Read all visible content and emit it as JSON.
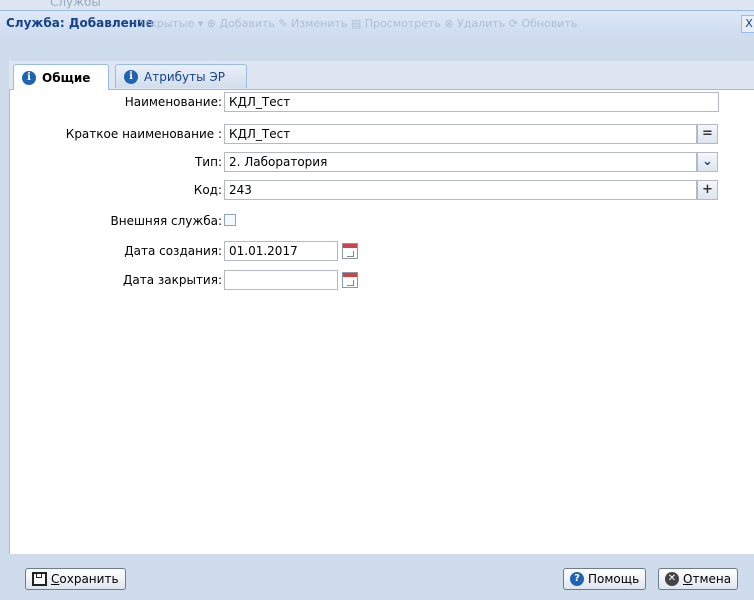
{
  "background": {
    "ghost_title": "Службы"
  },
  "dialog": {
    "title": "Служба: Добавление",
    "ghost_toolbar": "Открытые ▾   ⊕ Добавить   ✎ Изменить   ▤ Просмотреть   ⊗ Удалить   ⟳ Обновить",
    "close_glyph": "X"
  },
  "tabs": [
    {
      "label": "Общие",
      "active": true
    },
    {
      "label": "Атрибуты ЭР",
      "active": false
    }
  ],
  "form": {
    "name": {
      "label": "Наименование:",
      "value": "КДЛ_Тест"
    },
    "short_name": {
      "label": "Краткое наименование :",
      "value": "КДЛ_Тест",
      "trigger": "="
    },
    "type": {
      "label": "Тип:",
      "value": "2. Лаборатория",
      "trigger": "⌄"
    },
    "code": {
      "label": "Код:",
      "value": "243",
      "trigger": "+"
    },
    "external": {
      "label": "Внешняя служба:",
      "checked": false
    },
    "created": {
      "label": "Дата создания:",
      "value": "01.01.2017"
    },
    "closed": {
      "label": "Дата закрытия:",
      "value": ""
    }
  },
  "footer": {
    "save_prefix": "С",
    "save_rest": "охранить",
    "help": "Помощь",
    "cancel_prefix": "О",
    "cancel_rest": "тмена"
  },
  "colors": {
    "accent": "#15428b",
    "frame": "#cfdcec",
    "border": "#99bbe8"
  }
}
